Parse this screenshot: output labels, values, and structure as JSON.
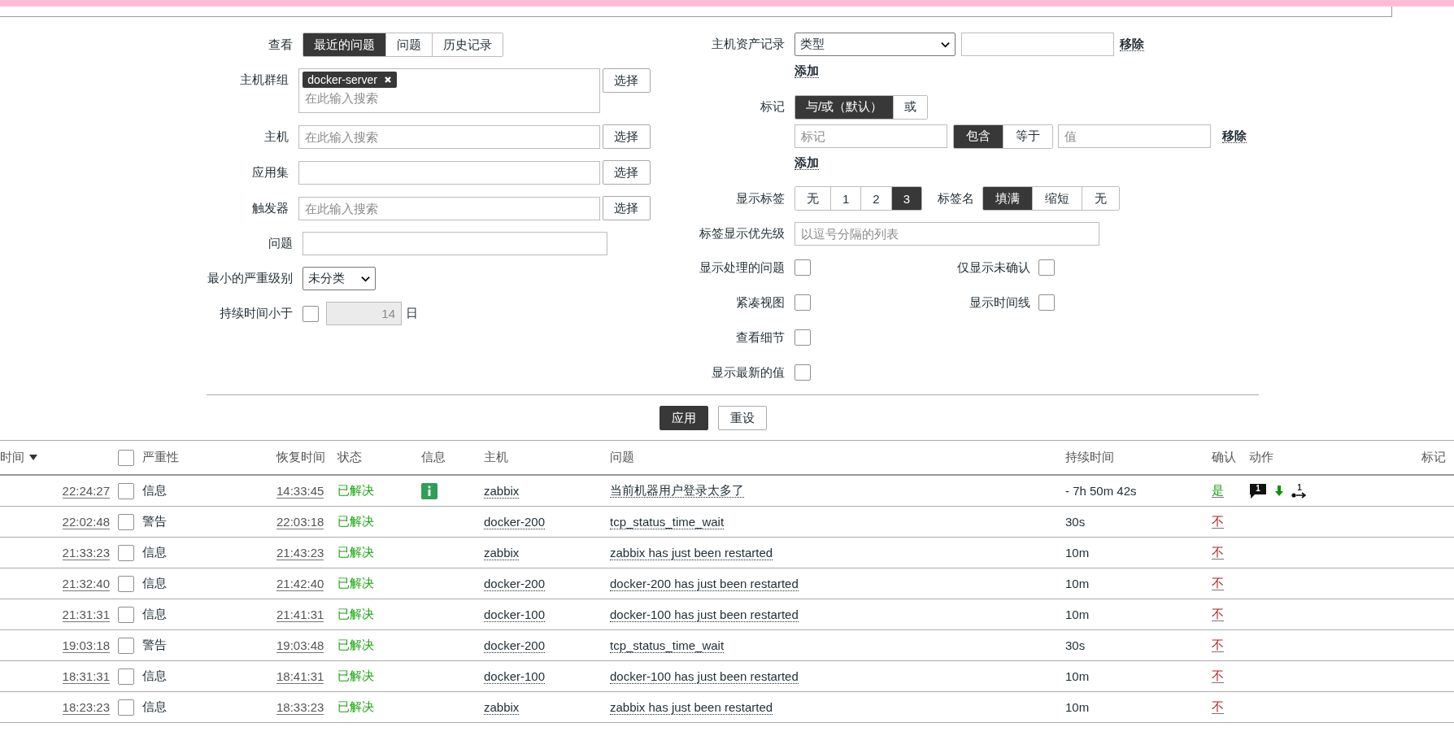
{
  "view": {
    "label": "查看",
    "tabs": [
      {
        "label": "最近的问题",
        "selected": true
      },
      {
        "label": "问题",
        "selected": false
      },
      {
        "label": "历史记录",
        "selected": false
      }
    ]
  },
  "host_groups": {
    "label": "主机群组",
    "chips": [
      {
        "label": "docker-server"
      }
    ],
    "placeholder": "在此输入搜索",
    "button": "选择"
  },
  "hosts": {
    "label": "主机",
    "placeholder": "在此输入搜索",
    "button": "选择"
  },
  "application": {
    "label": "应用集",
    "button": "选择"
  },
  "triggers": {
    "label": "触发器",
    "placeholder": "在此输入搜索",
    "button": "选择"
  },
  "problem": {
    "label": "问题"
  },
  "min_severity": {
    "label": "最小的严重级别",
    "value": "未分类"
  },
  "age_less_than": {
    "label": "持续时间小于",
    "checked": false,
    "value": "14",
    "unit": "日"
  },
  "inventory": {
    "label": "主机资产记录",
    "field": "类型",
    "remove": "移除",
    "add": "添加"
  },
  "tags": {
    "label": "标记",
    "operators": [
      {
        "label": "与/或（默认）",
        "selected": true
      },
      {
        "label": "或",
        "selected": false
      }
    ],
    "rows": [
      {
        "tag_placeholder": "标记",
        "conditions": [
          {
            "label": "包含",
            "selected": true
          },
          {
            "label": "等于",
            "selected": false
          }
        ],
        "value_placeholder": "值",
        "remove": "移除"
      }
    ],
    "add": "添加"
  },
  "show_tags": {
    "label": "显示标签",
    "options": [
      {
        "label": "无",
        "selected": false
      },
      {
        "label": "1",
        "selected": false
      },
      {
        "label": "2",
        "selected": false
      },
      {
        "label": "3",
        "selected": true
      }
    ]
  },
  "tag_name": {
    "label": "标签名",
    "options": [
      {
        "label": "填满",
        "selected": true
      },
      {
        "label": "缩短",
        "selected": false
      },
      {
        "label": "无",
        "selected": false
      }
    ]
  },
  "tag_priority": {
    "label": "标签显示优先级",
    "placeholder": "以逗号分隔的列表"
  },
  "option_rows": [
    [
      {
        "label": "显示处理的问题",
        "checked": false
      },
      {
        "label": "仅显示未确认",
        "checked": false
      }
    ],
    [
      {
        "label": "紧凑视图",
        "checked": false
      },
      {
        "label": "显示时间线",
        "checked": false
      }
    ],
    [
      {
        "label": "查看细节",
        "checked": false
      }
    ],
    [
      {
        "label": "显示最新的值",
        "checked": false
      }
    ]
  ],
  "buttons": [
    {
      "label": "应用",
      "kind": "primary"
    },
    {
      "label": "重设",
      "kind": "secondary"
    }
  ],
  "table": {
    "columns": [
      {
        "kind": "text",
        "label": "时间",
        "sorted": true
      },
      {
        "kind": "checkbox",
        "checked": false
      },
      {
        "kind": "text",
        "label": "严重性"
      },
      {
        "kind": "text",
        "label": "恢复时间"
      },
      {
        "kind": "text",
        "label": "状态"
      },
      {
        "kind": "text",
        "label": "信息"
      },
      {
        "kind": "text",
        "label": "主机"
      },
      {
        "kind": "text",
        "label": "问题"
      },
      {
        "kind": "text",
        "label": "持续时间"
      },
      {
        "kind": "text",
        "label": "确认"
      },
      {
        "kind": "text",
        "label": "动作"
      },
      {
        "kind": "text",
        "label": "标记"
      }
    ],
    "rows": [
      {
        "time": "22:24:27",
        "checked": false,
        "severity": "信息",
        "recovery_time": "14:33:45",
        "status": "已解决",
        "info": true,
        "host": "zabbix",
        "problem": "当前机器用户登录太多了",
        "duration": "- 7h 50m 42s",
        "ack": {
          "label": "是",
          "acknowledged": true
        },
        "actions": {
          "messages": "1",
          "escalations": "1"
        }
      },
      {
        "time": "22:02:48",
        "checked": false,
        "severity": "警告",
        "recovery_time": "22:03:18",
        "status": "已解决",
        "info": false,
        "host": "docker-200",
        "problem": "tcp_status_time_wait",
        "duration": "30s",
        "ack": {
          "label": "不",
          "acknowledged": false
        }
      },
      {
        "time": "21:33:23",
        "checked": false,
        "severity": "信息",
        "recovery_time": "21:43:23",
        "status": "已解决",
        "info": false,
        "host": "zabbix",
        "problem": "zabbix has just been restarted",
        "duration": "10m",
        "ack": {
          "label": "不",
          "acknowledged": false
        }
      },
      {
        "time": "21:32:40",
        "checked": false,
        "severity": "信息",
        "recovery_time": "21:42:40",
        "status": "已解决",
        "info": false,
        "host": "docker-200",
        "problem": "docker-200 has just been restarted",
        "duration": "10m",
        "ack": {
          "label": "不",
          "acknowledged": false
        }
      },
      {
        "time": "21:31:31",
        "checked": false,
        "severity": "信息",
        "recovery_time": "21:41:31",
        "status": "已解决",
        "info": false,
        "host": "docker-100",
        "problem": "docker-100 has just been restarted",
        "duration": "10m",
        "ack": {
          "label": "不",
          "acknowledged": false
        }
      },
      {
        "time": "19:03:18",
        "checked": false,
        "severity": "警告",
        "recovery_time": "19:03:48",
        "status": "已解决",
        "info": false,
        "host": "docker-200",
        "problem": "tcp_status_time_wait",
        "duration": "30s",
        "ack": {
          "label": "不",
          "acknowledged": false
        }
      },
      {
        "time": "18:31:31",
        "checked": false,
        "severity": "信息",
        "recovery_time": "18:41:31",
        "status": "已解决",
        "info": false,
        "host": "docker-100",
        "problem": "docker-100 has just been restarted",
        "duration": "10m",
        "ack": {
          "label": "不",
          "acknowledged": false
        }
      },
      {
        "time": "18:23:23",
        "checked": false,
        "severity": "信息",
        "recovery_time": "18:33:23",
        "status": "已解决",
        "info": false,
        "host": "zabbix",
        "problem": "zabbix has just been restarted",
        "duration": "10m",
        "ack": {
          "label": "不",
          "acknowledged": false
        }
      }
    ]
  }
}
